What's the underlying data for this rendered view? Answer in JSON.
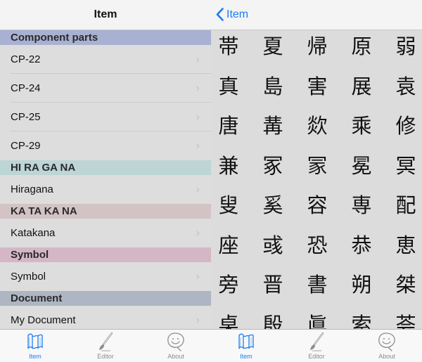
{
  "left": {
    "nav_title": "Item",
    "sections": [
      {
        "title": "Component parts",
        "color": "#a9b1d2",
        "items": [
          "CP-22",
          "CP-24",
          "CP-25",
          "CP-29"
        ]
      },
      {
        "title": "HI RA GA NA",
        "color": "#bdd5d5",
        "items": [
          "Hiragana"
        ]
      },
      {
        "title": "KA TA KA NA",
        "color": "#d3c3c5",
        "items": [
          "Katakana"
        ]
      },
      {
        "title": "Symbol",
        "color": "#d5b6c7",
        "items": [
          "Symbol"
        ]
      },
      {
        "title": "Document",
        "color": "#aeb5c3",
        "items": [
          "My Document"
        ]
      }
    ],
    "chevron": "›"
  },
  "right": {
    "back_label": "Item",
    "kanji_rows": [
      [
        "帯",
        "夏",
        "帰",
        "原",
        "弱"
      ],
      [
        "真",
        "島",
        "害",
        "展",
        "袁"
      ],
      [
        "唐",
        "冓",
        "欻",
        "乘",
        "修"
      ],
      [
        "兼",
        "冢",
        "冡",
        "冕",
        "冥"
      ],
      [
        "叟",
        "奚",
        "容",
        "専",
        "配"
      ],
      [
        "座",
        "彧",
        "恐",
        "恭",
        "恵"
      ],
      [
        "旁",
        "晋",
        "書",
        "朔",
        "桀"
      ],
      [
        "桌",
        "殷",
        "眞",
        "索",
        "荟"
      ]
    ]
  },
  "tabbar": {
    "tabs": [
      {
        "label": "Item",
        "icon": "map-icon",
        "active": true
      },
      {
        "label": "Editor",
        "icon": "brush-icon",
        "active": false
      },
      {
        "label": "About",
        "icon": "smiley-icon",
        "active": false
      }
    ]
  },
  "colors": {
    "accent": "#1a7cf0"
  }
}
